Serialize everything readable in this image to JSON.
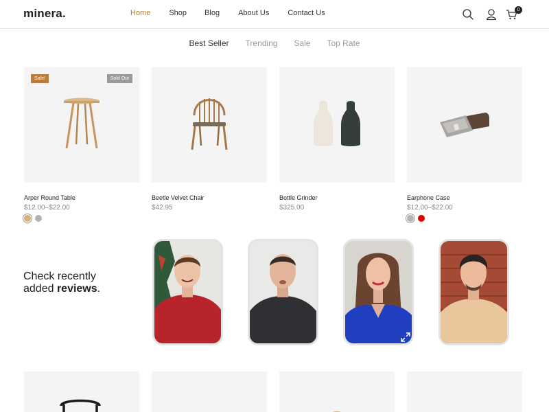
{
  "header": {
    "logo": "minera.",
    "nav": [
      "Home",
      "Shop",
      "Blog",
      "About Us",
      "Contact Us"
    ],
    "active_nav": "Home",
    "cart_count": "0",
    "icons": [
      "search-icon",
      "user-icon",
      "cart-icon"
    ]
  },
  "tabs": {
    "items": [
      "Best Seller",
      "Trending",
      "Sale",
      "Top Rate"
    ],
    "active": "Best Seller"
  },
  "products": [
    {
      "name": "Arper Round Table",
      "price": "$12.00–$22.00",
      "badge_sale": "Sale!",
      "badge_sold": "Sold Out",
      "swatches": [
        "#d8b27a",
        "#b3b3b3"
      ]
    },
    {
      "name": "Beetle Velvet Chair",
      "price": "$42.95"
    },
    {
      "name": "Bottle Grinder",
      "price": "$325.00"
    },
    {
      "name": "Earphone Case",
      "price": "$12.00–$22.00",
      "swatches": [
        "#b3b3b3",
        "#e00000"
      ]
    }
  ],
  "reviews": {
    "title_line1": "Check recently",
    "title_line2_prefix": "added ",
    "title_line2_bold": "reviews",
    "title_line2_suffix": "."
  },
  "colors": {
    "accent": "#b87d3c",
    "text": "#222222",
    "muted": "#888888",
    "sold_badge": "#9a9a9a"
  }
}
